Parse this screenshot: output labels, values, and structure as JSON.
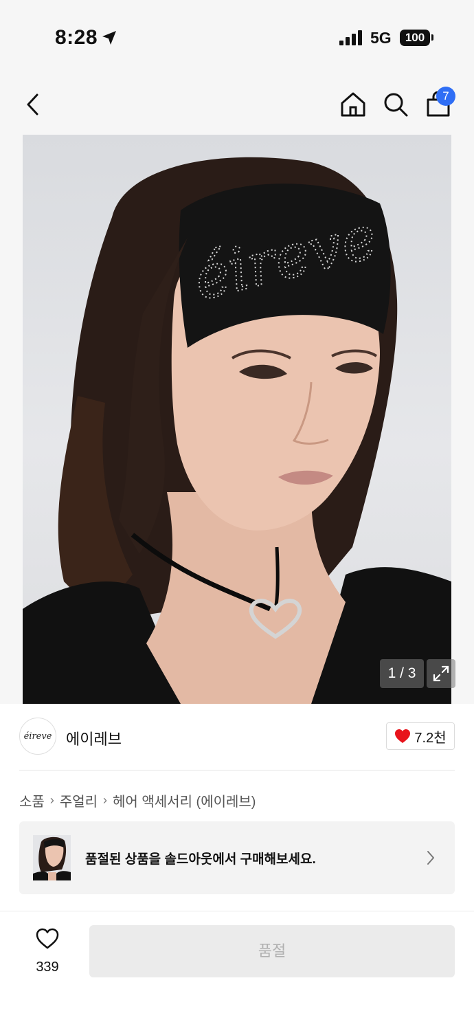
{
  "status_bar": {
    "time": "8:28",
    "network": "5G",
    "battery": "100"
  },
  "nav": {
    "back_icon": "chevron-left-icon",
    "home_icon": "home-icon",
    "search_icon": "search-icon",
    "cart_icon": "shopping-bag-icon",
    "cart_count": "7"
  },
  "gallery": {
    "headband_text": "éireve",
    "counter": "1 / 3",
    "expand_icon": "expand-icon"
  },
  "brand": {
    "logo_text": "éireve",
    "name": "에이레브",
    "likes": "7.2천",
    "heart_color": "#e8131b"
  },
  "breadcrumb": [
    "소품",
    "주얼리",
    "헤어 액세서리 (에이레브)"
  ],
  "soldout_card": {
    "text": "품절된 상품을 솔드아웃에서 구매해보세요."
  },
  "bottom_bar": {
    "wish_count": "339",
    "buy_label": "품절"
  }
}
